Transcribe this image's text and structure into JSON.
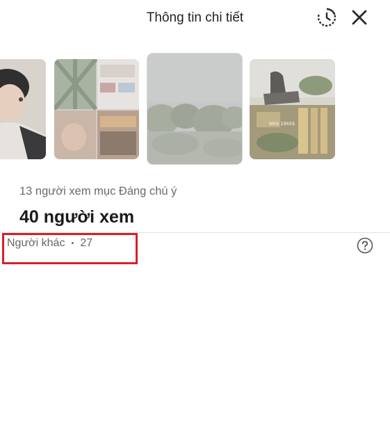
{
  "header": {
    "title": "Thông tin chi tiết",
    "history_icon": "history-clock-icon",
    "close_icon": "close-icon"
  },
  "stories": [
    {
      "name": "story-thumbnail-portrait"
    },
    {
      "name": "story-thumbnail-collage"
    },
    {
      "name": "story-thumbnail-trees",
      "selected": true
    },
    {
      "name": "story-thumbnail-outdoor",
      "overlay_text": "Nhà 18kkk"
    }
  ],
  "stats": {
    "highlight_views": "13 người xem mục Đáng chú ý",
    "total_views": "40 người xem"
  },
  "viewers": {
    "label": "Người khác",
    "separator": "•",
    "count": "27",
    "help_icon": "question-circle-icon"
  },
  "colors": {
    "annotation": "#d81f2a",
    "muted_text": "#666666",
    "divider": "#e3e3e3"
  }
}
